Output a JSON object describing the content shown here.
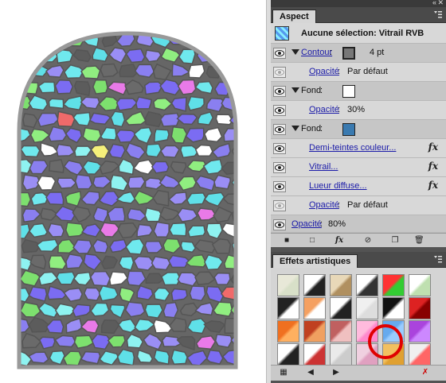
{
  "panel_controls": {
    "collapse_glyph": "«",
    "close_glyph": "✕"
  },
  "aspect": {
    "tab_label": "Aspect",
    "header_title": "Aucune sélection: Vitrail RVB",
    "rows": [
      {
        "label": "Contour",
        "value": "4 pt",
        "swatch_color": "#777777"
      },
      {
        "label": "Opacité",
        "value": "Par défaut"
      },
      {
        "label": "Fond",
        "swatch_color": "#ffffff"
      },
      {
        "label": "Opacité",
        "value": "30%"
      },
      {
        "label": "Fond",
        "swatch_color": "#3a7ab0"
      },
      {
        "label": "Demi-teintes couleur..."
      },
      {
        "label": "Vitrail..."
      },
      {
        "label": "Lueur diffuse..."
      },
      {
        "label": "Opacité",
        "value": "Par défaut"
      },
      {
        "label": "Opacité",
        "value": "80%"
      }
    ],
    "fx_glyph": "fx"
  },
  "effets": {
    "tab_label": "Effets artistiques"
  },
  "colors": {
    "panel_bg": "#535353",
    "link": "#1a1aa8",
    "highlight_ring": "#e00000"
  }
}
